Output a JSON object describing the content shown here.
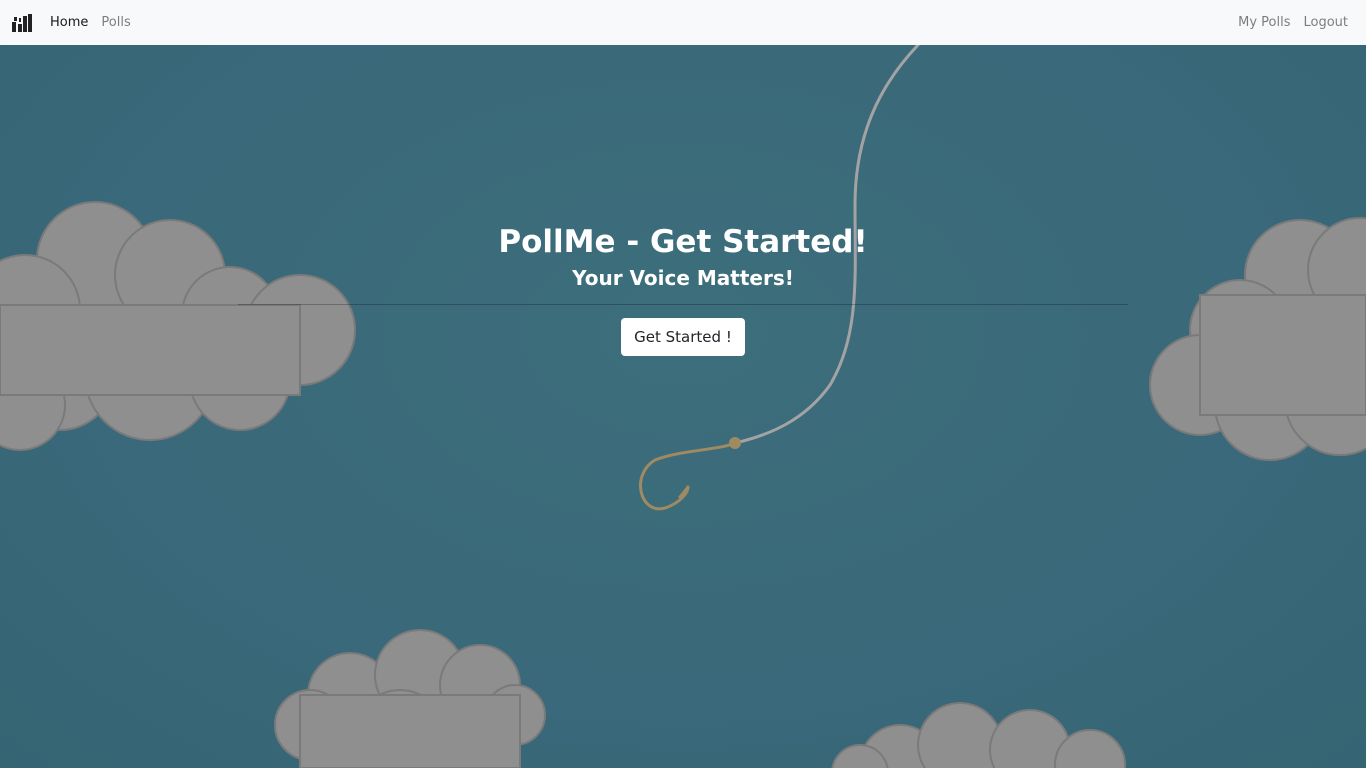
{
  "navbar": {
    "brand_icon": "poll-logo-icon",
    "left_links": [
      {
        "label": "Home",
        "active": true
      },
      {
        "label": "Polls",
        "active": false
      }
    ],
    "right_links": [
      {
        "label": "My Polls"
      },
      {
        "label": "Logout"
      }
    ]
  },
  "hero": {
    "title": "PollMe - Get Started!",
    "subtitle": "Your Voice Matters!",
    "cta_label": "Get Started !",
    "background_color": "#39697a",
    "cloud_color": "#8f8f8f",
    "hook_color": "#a08a62"
  }
}
